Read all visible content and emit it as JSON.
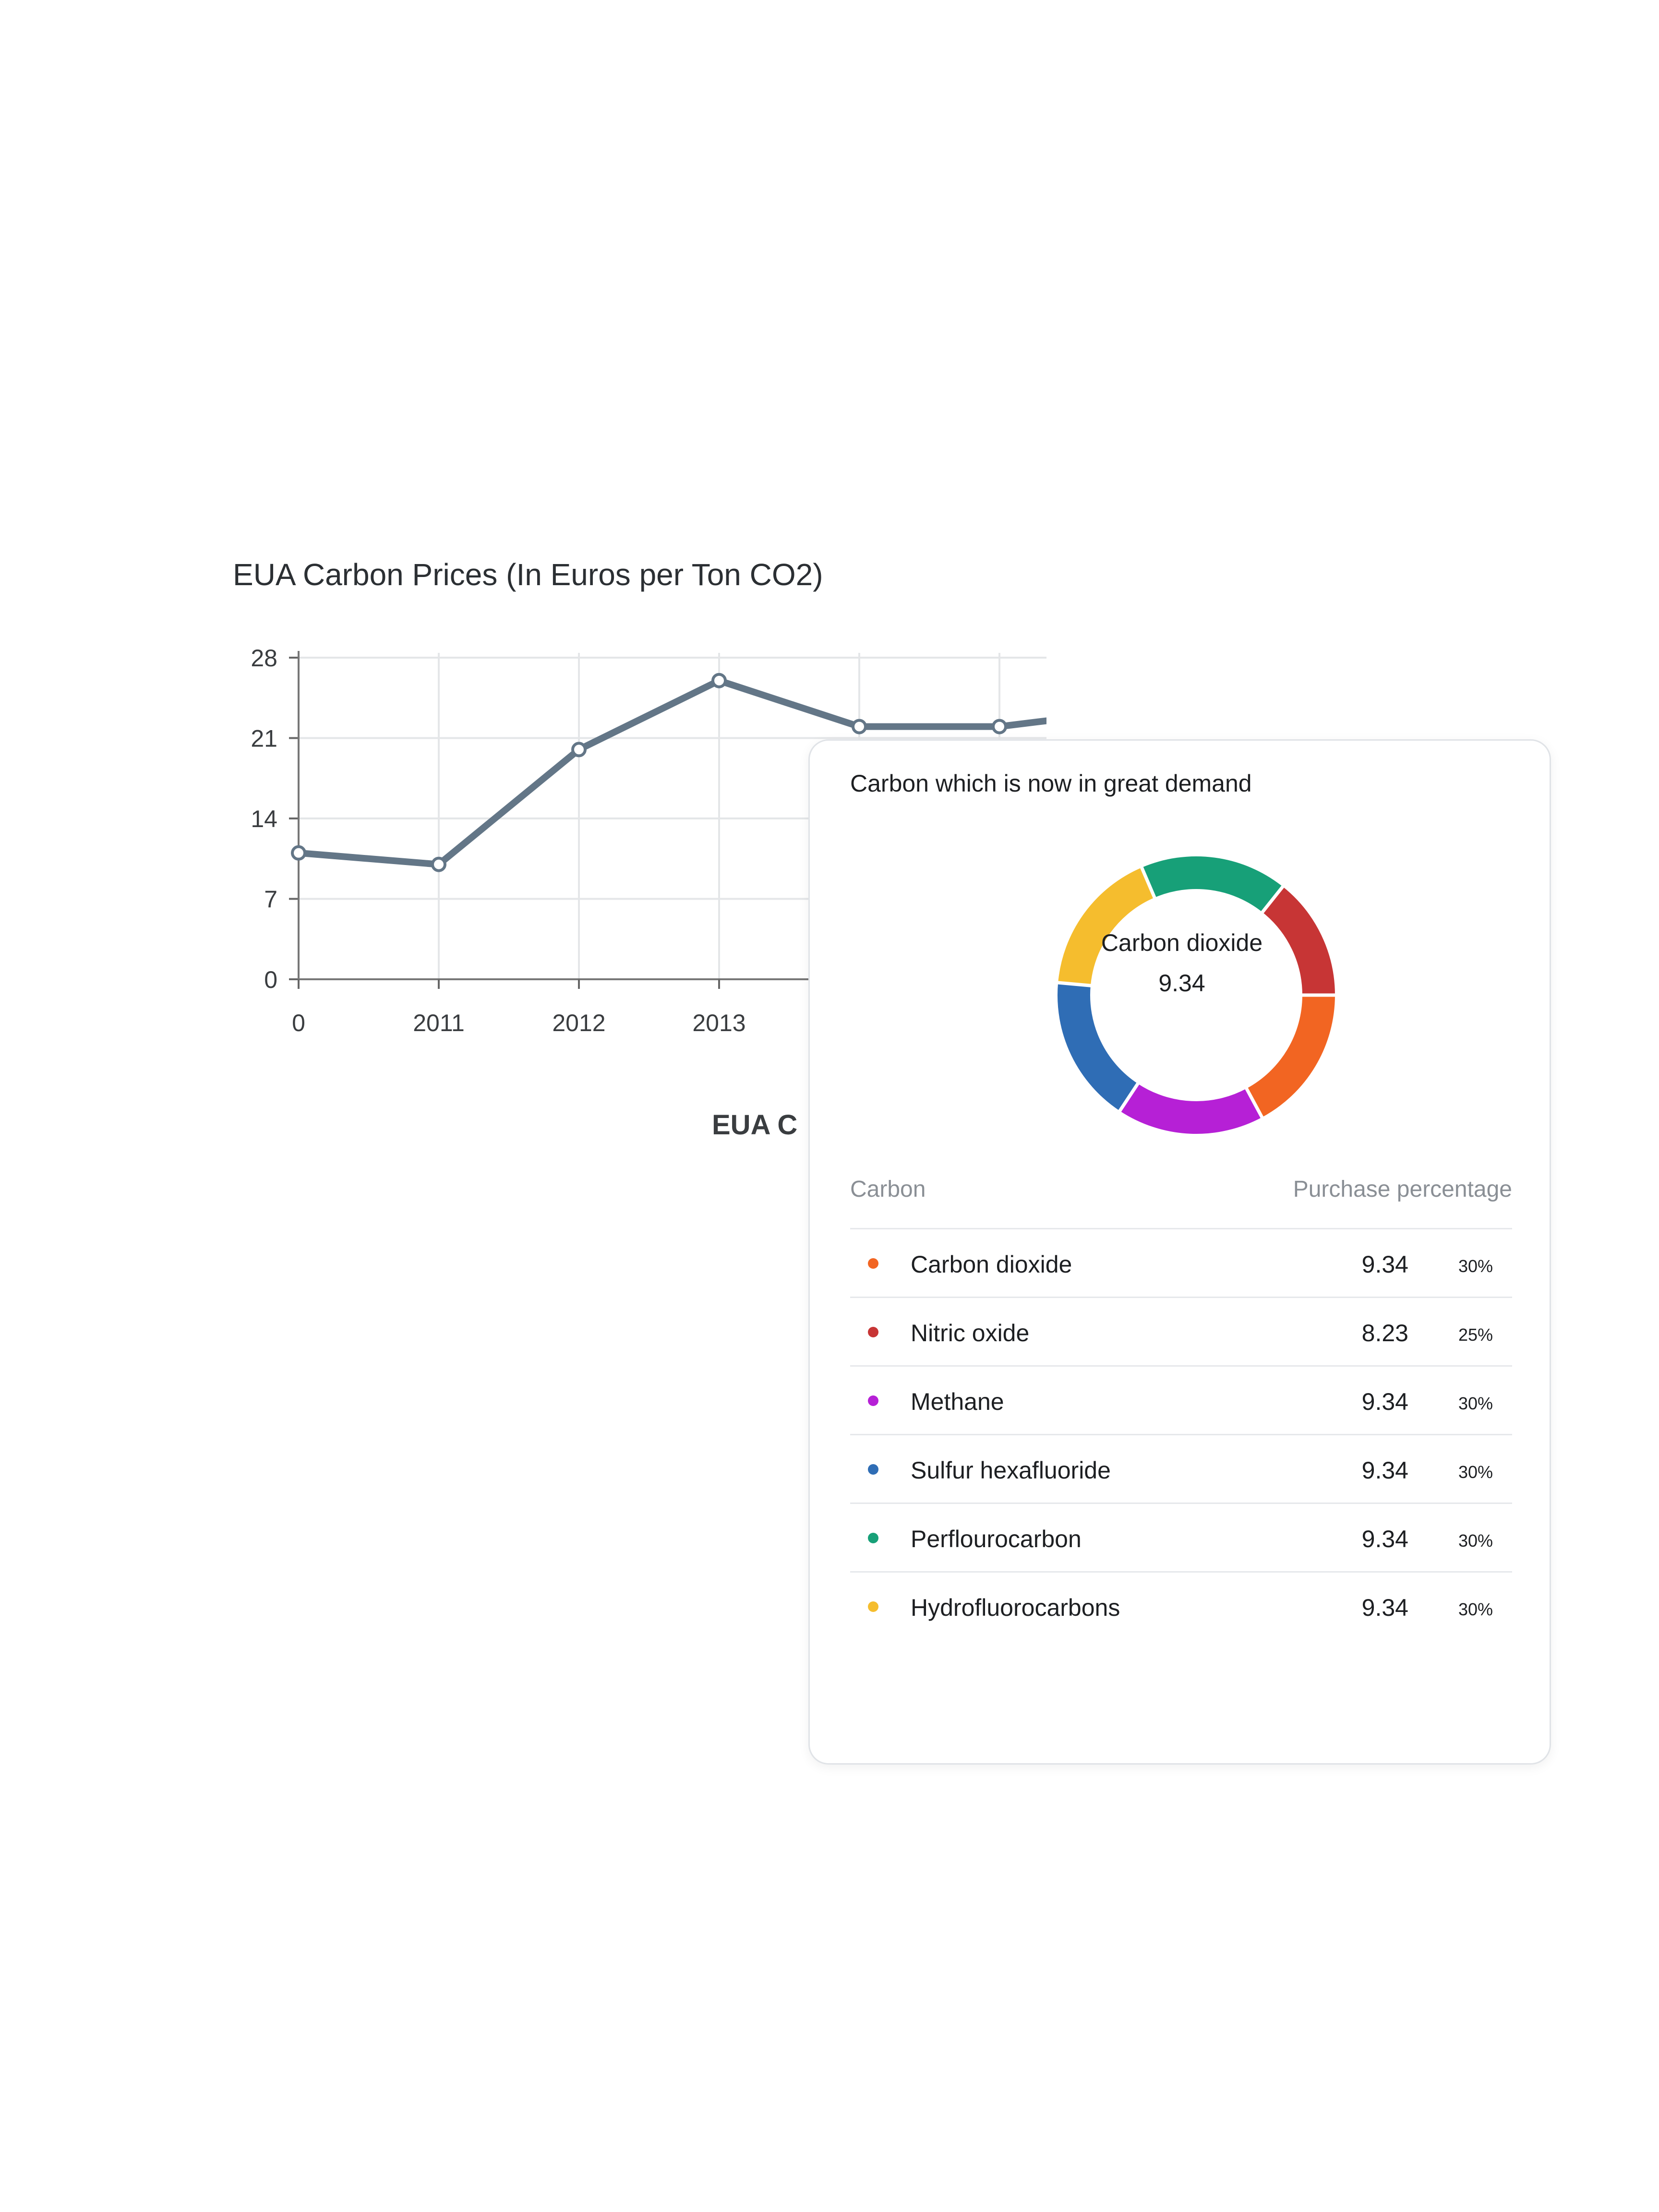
{
  "chart_data": [
    {
      "type": "line",
      "title": "EUA Carbon Prices (In Euros per Ton CO2)",
      "x_ticks": [
        "0",
        "2011",
        "2012",
        "2013"
      ],
      "y_ticks": [
        0,
        7,
        14,
        21,
        28
      ],
      "ylim": [
        0,
        28
      ],
      "grid": true,
      "series": [
        {
          "values": [
            11,
            10,
            20,
            26,
            22,
            22,
            23.5
          ]
        }
      ],
      "caption_fragment": "EUA C",
      "color": "#637687"
    },
    {
      "type": "pie",
      "title": "Carbon which is now in great demand",
      "center_label": "Carbon dioxide",
      "center_value": "9.34",
      "slices": [
        {
          "name": "Carbon dioxide",
          "value": 30,
          "color": "#f26522"
        },
        {
          "name": "Methane",
          "value": 30,
          "color": "#b620d6"
        },
        {
          "name": "Sulfur hexafluoride",
          "value": 30,
          "color": "#2f6db5"
        },
        {
          "name": "Hydrofluorocarbons",
          "value": 30,
          "color": "#f5bd2e"
        },
        {
          "name": "Perflourocarbon",
          "value": 30,
          "color": "#17a078"
        },
        {
          "name": "Nitric oxide",
          "value": 25,
          "color": "#c73535"
        }
      ]
    }
  ],
  "table": {
    "col1": "Carbon",
    "col2": "Purchase percentage",
    "rows": [
      {
        "name": "Carbon dioxide",
        "value": "9.34",
        "pct": "30%",
        "color": "#f26522"
      },
      {
        "name": "Nitric oxide",
        "value": "8.23",
        "pct": "25%",
        "color": "#c73535"
      },
      {
        "name": "Methane",
        "value": "9.34",
        "pct": "30%",
        "color": "#b620d6"
      },
      {
        "name": "Sulfur hexafluoride",
        "value": "9.34",
        "pct": "30%",
        "color": "#2f6db5"
      },
      {
        "name": "Perflourocarbon",
        "value": "9.34",
        "pct": "30%",
        "color": "#17a078"
      },
      {
        "name": "Hydrofluorocarbons",
        "value": "9.34",
        "pct": "30%",
        "color": "#f5bd2e"
      }
    ]
  }
}
